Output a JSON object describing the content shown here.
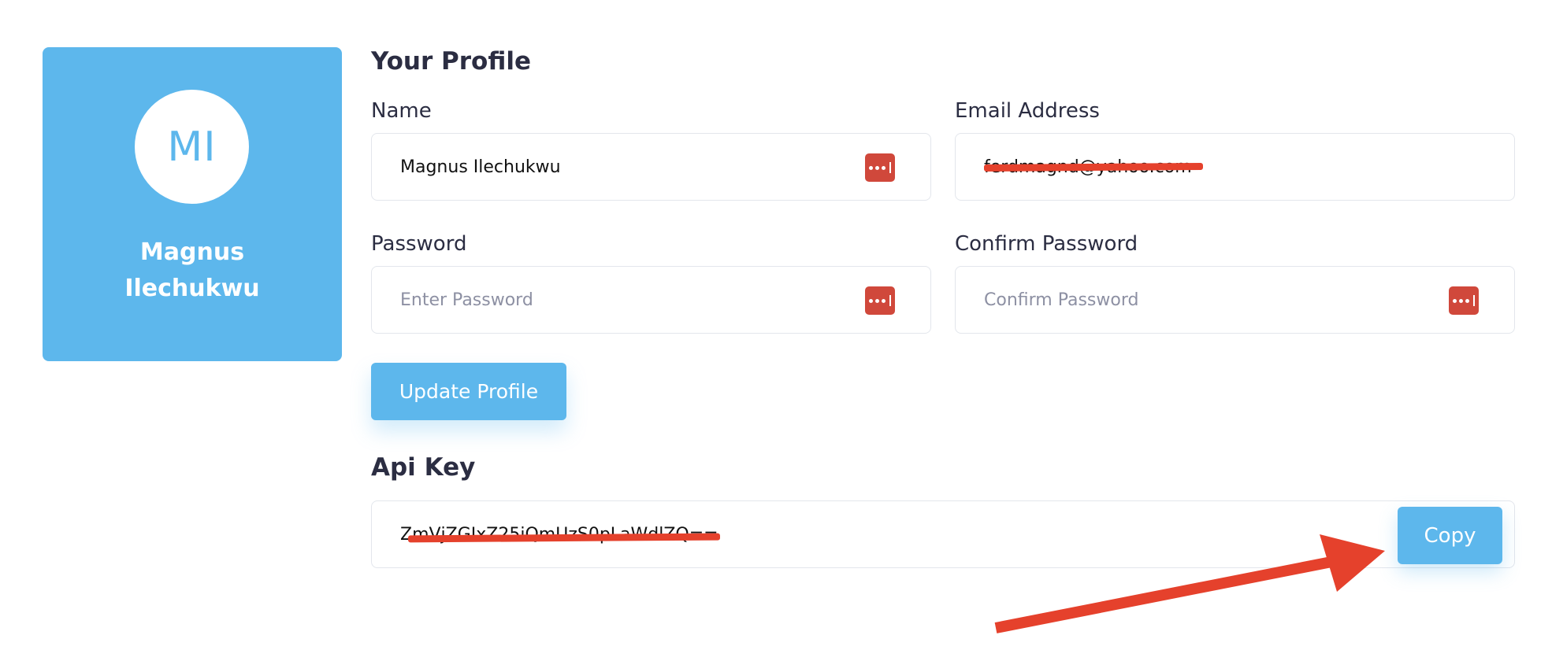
{
  "profile_card": {
    "initials": "MI",
    "name": "Magnus\nIlechukwu"
  },
  "profile_form": {
    "title": "Your Profile",
    "name": {
      "label": "Name",
      "value": "Magnus Ilechukwu"
    },
    "email": {
      "label": "Email Address",
      "value": "ferdmagnd@yahoo.com"
    },
    "password": {
      "label": "Password",
      "placeholder": "Enter Password"
    },
    "confirm_password": {
      "label": "Confirm Password",
      "placeholder": "Confirm Password"
    },
    "update_button": "Update Profile"
  },
  "api_key": {
    "title": "Api Key",
    "value": "ZmVjZGIxZ25iQmUzS0pLaWdlZQ==",
    "copy_button": "Copy"
  },
  "icons": {
    "password_manager": "password-dots-icon"
  },
  "colors": {
    "primary": "#5db7ec",
    "password_icon": "#d0483b",
    "annotation": "#e5412c",
    "text": "#2b2d42"
  }
}
